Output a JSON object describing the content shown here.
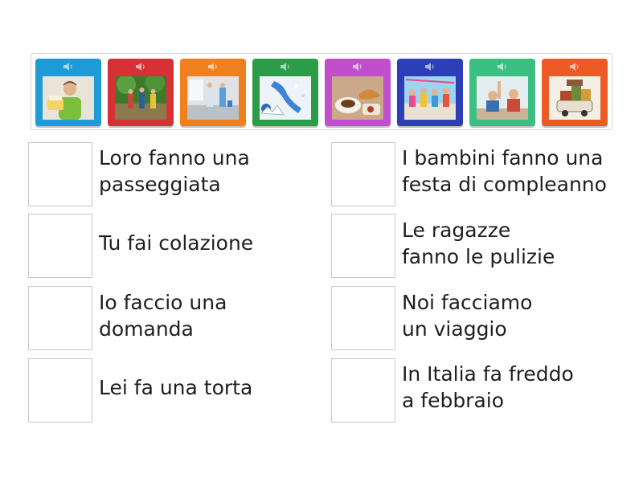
{
  "tiles": [
    {
      "color": "#1e9ad6",
      "scene": "person-holding-cake",
      "icon": "speaker-icon"
    },
    {
      "color": "#d63235",
      "scene": "people-hiking",
      "icon": "speaker-icon"
    },
    {
      "color": "#f0801d",
      "scene": "girls-cleaning",
      "icon": "speaker-icon"
    },
    {
      "color": "#2b9c48",
      "scene": "snowy-italy-map",
      "icon": "speaker-icon"
    },
    {
      "color": "#c14fcc",
      "scene": "breakfast-coffee-croissant",
      "icon": "speaker-icon"
    },
    {
      "color": "#2d3fb8",
      "scene": "children-party",
      "icon": "speaker-icon"
    },
    {
      "color": "#3cbf83",
      "scene": "student-raising-hand",
      "icon": "speaker-icon"
    },
    {
      "color": "#ec5a25",
      "scene": "car-loaded-with-luggage",
      "icon": "speaker-icon"
    }
  ],
  "answers": [
    {
      "lines": [
        "Loro fanno una",
        "passeggiata"
      ]
    },
    {
      "lines": [
        "I bambini fanno una",
        "festa di compleanno"
      ]
    },
    {
      "lines": [
        "Tu fai colazione"
      ]
    },
    {
      "lines": [
        "Le ragazze",
        "fanno le pulizie"
      ]
    },
    {
      "lines": [
        "Io faccio una",
        "domanda"
      ]
    },
    {
      "lines": [
        "Noi facciamo",
        "un viaggio"
      ]
    },
    {
      "lines": [
        "Lei fa una torta"
      ]
    },
    {
      "lines": [
        "In Italia fa freddo",
        "a febbraio"
      ]
    }
  ]
}
